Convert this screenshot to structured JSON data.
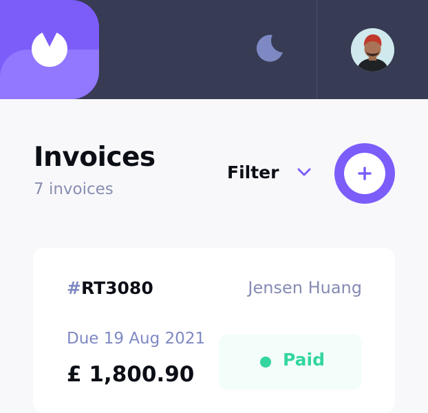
{
  "header": {
    "logo_icon": "logo-mark",
    "theme_toggle_icon": "moon-icon",
    "avatar": "user-avatar"
  },
  "main": {
    "title": "Invoices",
    "subtitle": "7 invoices",
    "filter_label": "Filter",
    "filter_icon": "chevron-down-icon",
    "new_invoice_icon": "plus-icon"
  },
  "invoices": [
    {
      "id_prefix": "#",
      "id": "RT3080",
      "client": "Jensen Huang",
      "due": "Due 19 Aug 2021",
      "amount": "£ 1,800.90",
      "status": "Paid"
    }
  ],
  "colors": {
    "accent": "#7C5DFA",
    "accent_light": "#9277FF",
    "header_bg": "#373B53",
    "page_bg": "#F8F8FB",
    "paid": "#33D69F",
    "paid_bg": "#F3FDF9"
  }
}
